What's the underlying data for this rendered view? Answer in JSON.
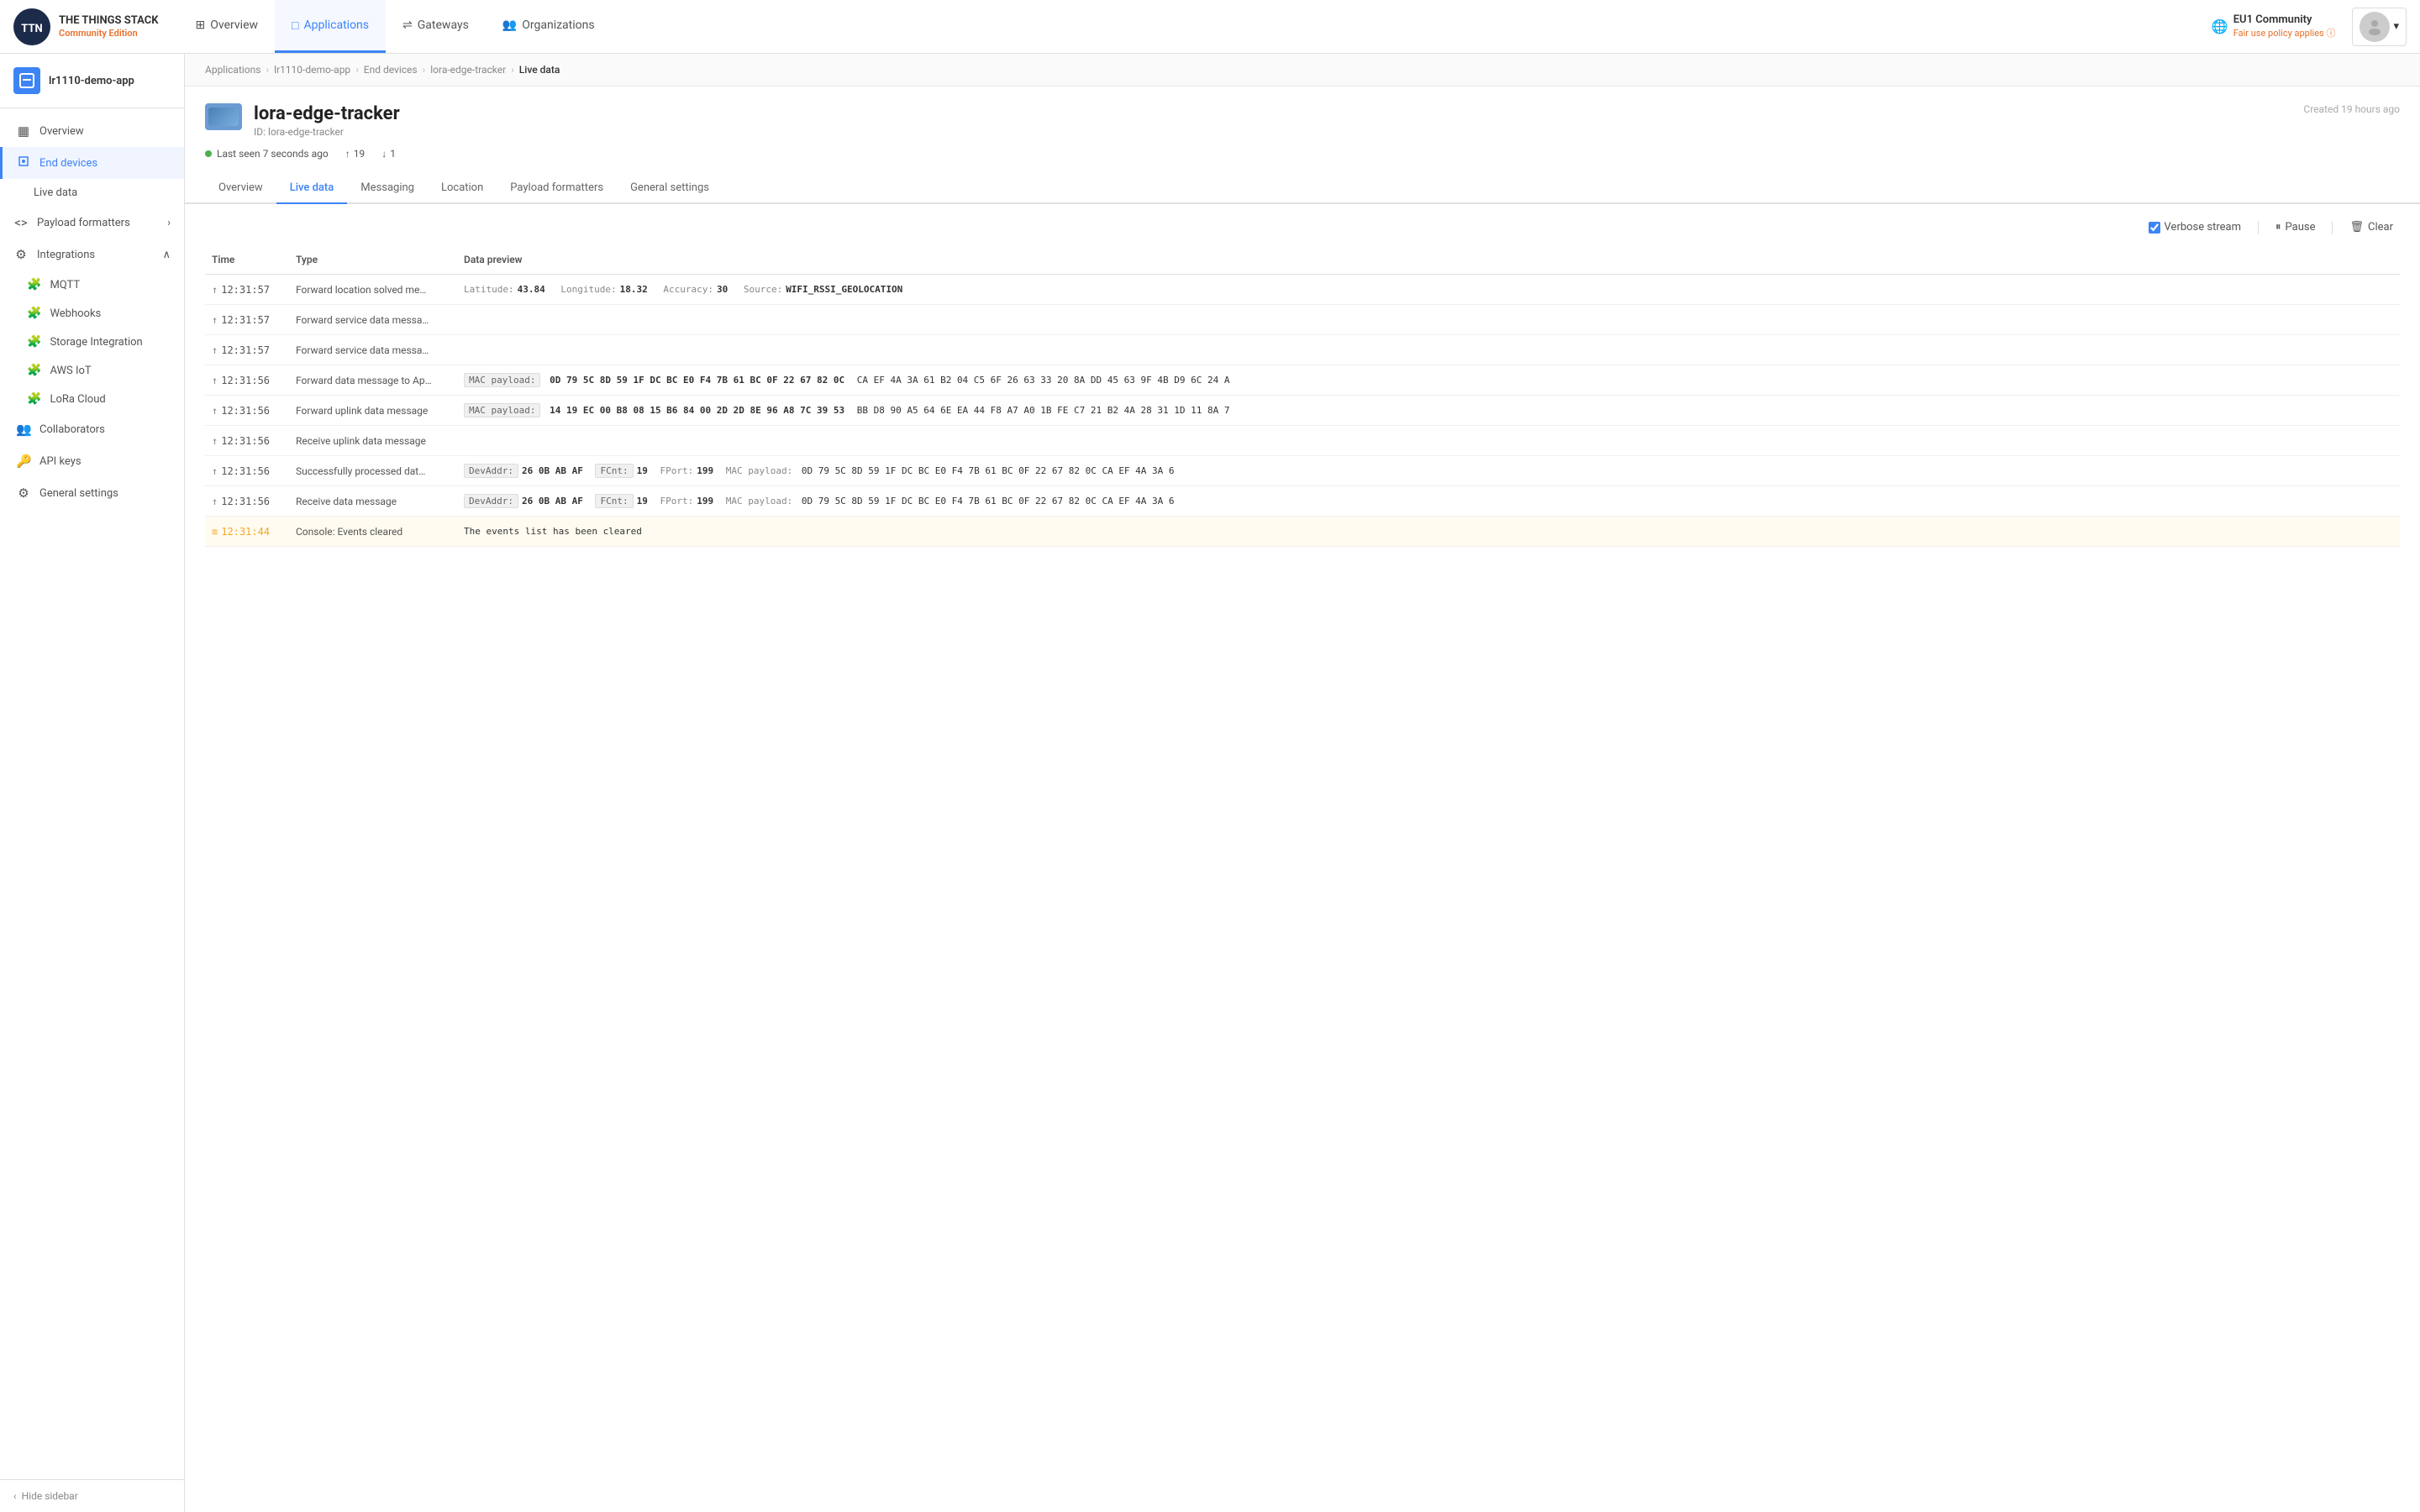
{
  "app": {
    "logo_alt": "The Things Network",
    "stack_title": "THE THINGS STACK",
    "stack_subtitle": "Community Edition"
  },
  "top_nav": {
    "items": [
      {
        "id": "overview",
        "label": "Overview",
        "icon": "⊞",
        "active": false
      },
      {
        "id": "applications",
        "label": "Applications",
        "icon": "□",
        "active": true
      },
      {
        "id": "gateways",
        "label": "Gateways",
        "icon": "⇌",
        "active": false
      },
      {
        "id": "organizations",
        "label": "Organizations",
        "icon": "👥",
        "active": false
      }
    ],
    "region": {
      "name": "EU1 Community",
      "policy": "Fair use policy applies",
      "policy_icon": "?"
    },
    "user": {
      "avatar_alt": "User avatar",
      "dropdown_label": "Account"
    }
  },
  "breadcrumb": {
    "items": [
      {
        "label": "Applications",
        "link": true
      },
      {
        "label": "lr1110-demo-app",
        "link": true
      },
      {
        "label": "End devices",
        "link": true
      },
      {
        "label": "lora-edge-tracker",
        "link": true
      },
      {
        "label": "Live data",
        "link": false
      }
    ]
  },
  "sidebar": {
    "app_name": "lr1110-demo-app",
    "nav_items": [
      {
        "id": "overview",
        "label": "Overview",
        "icon": "▦",
        "active": false
      },
      {
        "id": "end-devices",
        "label": "End devices",
        "icon": "⚙",
        "active": true
      },
      {
        "id": "live-data",
        "label": "Live data",
        "icon": "▦",
        "active": false,
        "sub": true
      },
      {
        "id": "payload-formatters",
        "label": "Payload formatters",
        "icon": "<>",
        "active": false,
        "expandable": true
      },
      {
        "id": "integrations",
        "label": "Integrations",
        "icon": "⚙",
        "active": false,
        "expandable": true,
        "expanded": true
      }
    ],
    "integrations_sub": [
      {
        "id": "mqtt",
        "label": "MQTT",
        "icon": "🧩"
      },
      {
        "id": "webhooks",
        "label": "Webhooks",
        "icon": "🧩"
      },
      {
        "id": "storage",
        "label": "Storage Integration",
        "icon": "🧩"
      },
      {
        "id": "aws-iot",
        "label": "AWS IoT",
        "icon": "🧩"
      },
      {
        "id": "lora-cloud",
        "label": "LoRa Cloud",
        "icon": "🧩"
      }
    ],
    "bottom_items": [
      {
        "id": "collaborators",
        "label": "Collaborators",
        "icon": "👥"
      },
      {
        "id": "api-keys",
        "label": "API keys",
        "icon": "🔑"
      },
      {
        "id": "general-settings",
        "label": "General settings",
        "icon": "⚙"
      }
    ],
    "hide_label": "Hide sidebar"
  },
  "device": {
    "name": "lora-edge-tracker",
    "id_prefix": "ID:",
    "id": "lora-edge-tracker",
    "status": "Last seen 7 seconds ago",
    "uplink_count": "19",
    "downlink_count": "1",
    "created": "Created 19 hours ago"
  },
  "tabs": [
    {
      "id": "overview",
      "label": "Overview",
      "active": false
    },
    {
      "id": "live-data",
      "label": "Live data",
      "active": true
    },
    {
      "id": "messaging",
      "label": "Messaging",
      "active": false
    },
    {
      "id": "location",
      "label": "Location",
      "active": false
    },
    {
      "id": "payload-formatters",
      "label": "Payload formatters",
      "active": false
    },
    {
      "id": "general-settings",
      "label": "General settings",
      "active": false
    }
  ],
  "toolbar": {
    "verbose_label": "Verbose stream",
    "pause_label": "Pause",
    "clear_label": "Clear"
  },
  "table": {
    "headers": [
      "Time",
      "Type",
      "Data preview"
    ],
    "rows": [
      {
        "id": "row1",
        "direction": "up",
        "time": "12:31:57",
        "type": "Forward location solved me…",
        "data_type": "coords",
        "data": "Latitude: 43.84    Longitude: 18.32    Accuracy: 30  Source:  WIFI_RSSI_GEOLOCATION",
        "highlight": false
      },
      {
        "id": "row2",
        "direction": "up",
        "time": "12:31:57",
        "type": "Forward service data messa…",
        "data": "",
        "highlight": false
      },
      {
        "id": "row3",
        "direction": "up",
        "time": "12:31:57",
        "type": "Forward service data messa…",
        "data": "",
        "highlight": false
      },
      {
        "id": "row4",
        "direction": "up",
        "time": "12:31:56",
        "type": "Forward data message to Ap…",
        "data_type": "mac",
        "label": "MAC payload:",
        "value": "0D 79 5C 8D 59 1F DC BC E0 F4 7B 61 BC 0F 22 67 82 0C",
        "extra": "CA EF 4A 3A 61 B2 04 C5 6F 26 63 33 20 8A DD 45 63 9F 4B D9 6C 24 A",
        "highlight": false
      },
      {
        "id": "row5",
        "direction": "up",
        "time": "12:31:56",
        "type": "Forward uplink data message",
        "data_type": "mac",
        "label": "MAC payload:",
        "value": "14 19 EC 00 B8 08 15 B6 84 00 2D 2D 8E 96 A8 7C 39 53",
        "extra": "BB D8 90 A5 64 6E EA 44 F8 A7 A0 1B FE C7 21 B2 4A 28 31 1D 11 8A 7",
        "highlight": false
      },
      {
        "id": "row6",
        "direction": "up",
        "time": "12:31:56",
        "type": "Receive uplink data message",
        "data": "",
        "highlight": false
      },
      {
        "id": "row7",
        "direction": "up",
        "time": "12:31:56",
        "type": "Successfully processed dat…",
        "data_type": "addr",
        "dev_addr_label": "DevAddr:",
        "dev_addr": "26 0B AB AF",
        "fcnt_label": "FCnt:",
        "fcnt": "19",
        "fport_label": "FPort:",
        "fport": "199",
        "mac_label": "MAC payload:",
        "mac": "0D 79 5C 8D 59 1F DC BC E0 F4 7B 61 BC 0F 22 67 82 0C CA EF 4A 3A 6",
        "highlight": false
      },
      {
        "id": "row8",
        "direction": "up",
        "time": "12:31:56",
        "type": "Receive data message",
        "data_type": "addr",
        "dev_addr_label": "DevAddr:",
        "dev_addr": "26 0B AB AF",
        "fcnt_label": "FCnt:",
        "fcnt": "19",
        "fport_label": "FPort:",
        "fport": "199",
        "mac_label": "MAC payload:",
        "mac": "0D 79 5C 8D 59 1F DC BC E0 F4 7B 61 BC 0F 22 67 82 0C CA EF 4A 3A 6",
        "highlight": false
      },
      {
        "id": "row9",
        "direction": "warn",
        "time": "12:31:44",
        "type": "Console: Events cleared",
        "data": "The events list has been cleared",
        "highlight": true
      }
    ]
  }
}
